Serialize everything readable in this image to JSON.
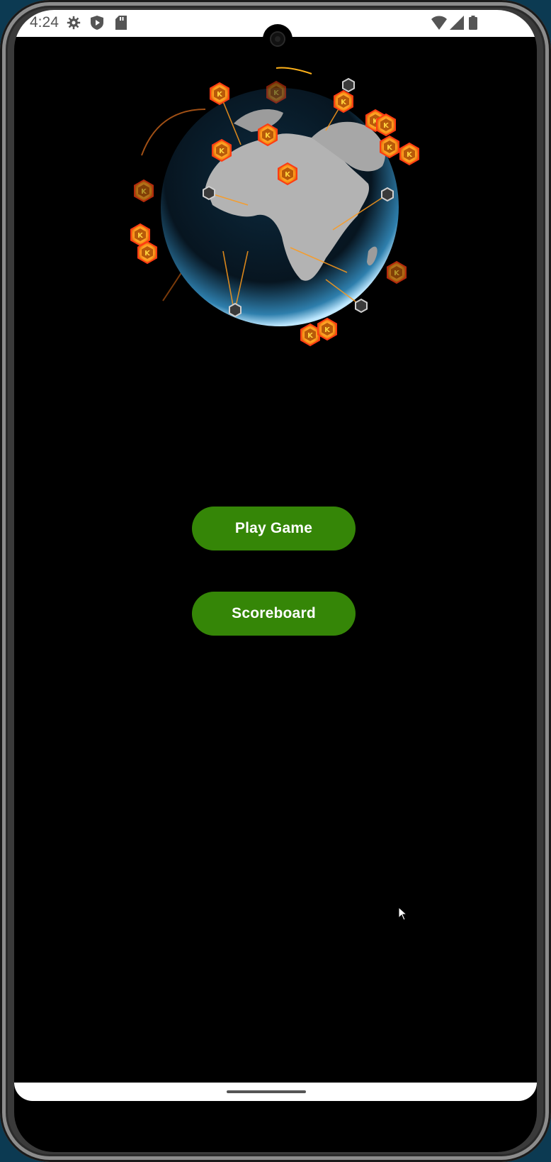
{
  "status_bar": {
    "time": "4:24",
    "left_icons": [
      "settings-icon",
      "shield-play-icon",
      "sd-card-icon"
    ],
    "right_icons": [
      "wifi-icon",
      "signal-icon",
      "battery-icon"
    ]
  },
  "hero": {
    "image": "globe-network-icon",
    "colors": {
      "accent": "#ff9a1a",
      "globe": "#5fb8e6"
    }
  },
  "menu": {
    "play_label": "Play Game",
    "scoreboard_label": "Scoreboard",
    "button_color": "#358607"
  }
}
